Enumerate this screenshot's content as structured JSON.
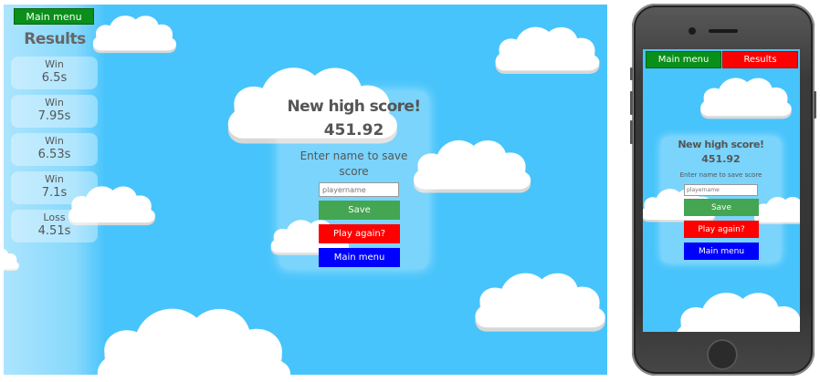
{
  "colors": {
    "sky": "#47c4fb",
    "main_menu_green": "#0a8f1a",
    "save_green": "#44a552",
    "play_again_red": "#ff0000",
    "main_menu_blue": "#0000ff",
    "cloud_white": "#ffffff"
  },
  "desktop": {
    "top_main_menu_label": "Main menu",
    "results": {
      "title": "Results",
      "items": [
        {
          "outcome": "Win",
          "time": "6.5s"
        },
        {
          "outcome": "Win",
          "time": "7.95s"
        },
        {
          "outcome": "Win",
          "time": "6.53s"
        },
        {
          "outcome": "Win",
          "time": "7.1s"
        },
        {
          "outcome": "Loss",
          "time": "4.51s"
        }
      ]
    },
    "high_score": {
      "title": "New high score!",
      "score": "451.92",
      "prompt": "Enter name to save score",
      "name_placeholder": "playername",
      "save_label": "Save",
      "play_again_label": "Play again?",
      "main_menu_label": "Main menu"
    }
  },
  "phone": {
    "main_menu_label": "Main menu",
    "results_label": "Results",
    "high_score": {
      "title": "New high score!",
      "score": "451.92",
      "prompt": "Enter name to save score",
      "name_placeholder": "playername",
      "save_label": "Save",
      "play_again_label": "Play again?",
      "main_menu_label": "Main menu"
    }
  }
}
